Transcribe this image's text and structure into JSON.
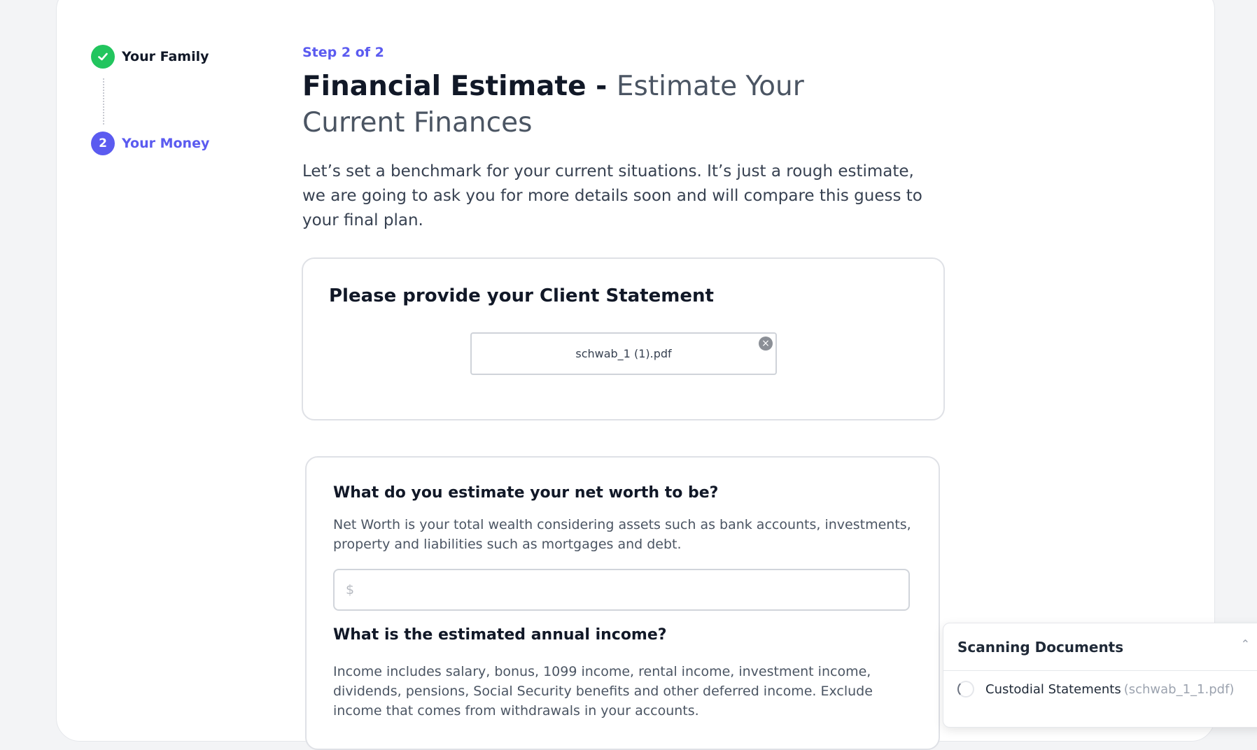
{
  "stepper": {
    "steps": [
      {
        "number": "",
        "label": "Your Family",
        "status": "complete"
      },
      {
        "number": "2",
        "label": "Your Money",
        "status": "active"
      }
    ]
  },
  "main": {
    "step_indicator": "Step 2 of 2",
    "title_strong": "Financial Estimate - ",
    "title_light": "Estimate Your Current Finances",
    "intro": "Let’s set a benchmark for your current situations. It’s just a rough estimate, we are going to ask you for more details soon and will compare this guess to your final plan."
  },
  "statement_card": {
    "heading": "Please provide your Client Statement",
    "file_name": "schwab_1 (1).pdf",
    "remove_icon": "close-circle-icon"
  },
  "estimate_card": {
    "net_worth_question": "What do you estimate your net worth to be?",
    "net_worth_help": "Net Worth is your total wealth considering assets such as bank accounts, investments, property and liabilities such as mortgages and debt.",
    "net_worth_placeholder": "$",
    "net_worth_value": "",
    "income_question": "What is the estimated annual income?",
    "income_help": "Income includes salary, bonus, 1099 income, rental income, investment income, dividends, pensions, Social Security benefits and other deferred income. Exclude income that comes from withdrawals in your accounts."
  },
  "scan_panel": {
    "title": "Scanning Documents",
    "toggle_icon": "chevron-up-icon",
    "items": [
      {
        "doc_type": "Custodial Statements",
        "file": "(schwab_1_1.pdf)",
        "status_icon": "spinner-icon"
      }
    ]
  },
  "colors": {
    "accent": "#5b5bf0",
    "success": "#22c55e"
  }
}
